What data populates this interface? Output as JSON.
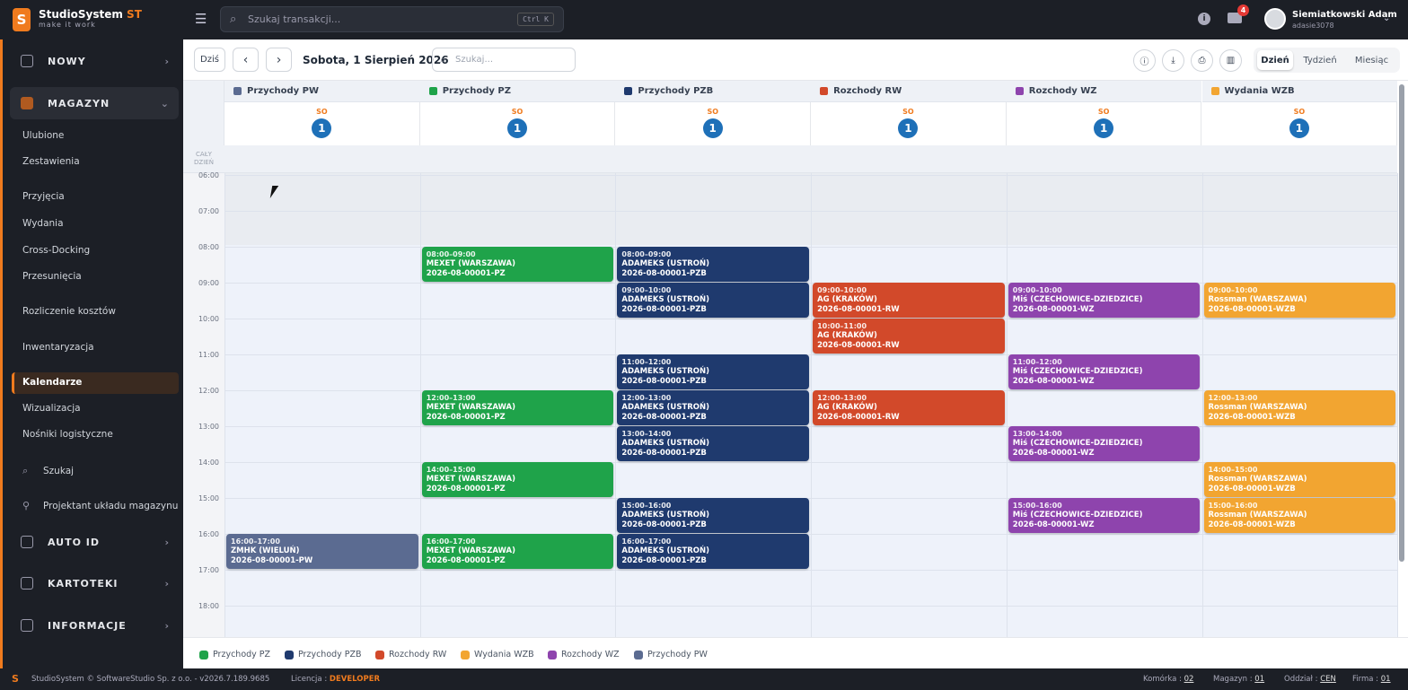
{
  "app": {
    "brand_main": "StudioSystem",
    "brand_accent": "ST",
    "tagline": "make it work",
    "logo_letter": "S"
  },
  "topbar": {
    "search_placeholder": "Szukaj transakcji...",
    "search_shortcut": "Ctrl K",
    "notifications_count": "4",
    "user_name": "Siemiatkowski Adam",
    "user_login": "adasie3078"
  },
  "sidebar": {
    "sections": {
      "nowy": "NOWY",
      "magazyn": "MAGAZYN",
      "auto_id": "AUTO ID",
      "kartoteki": "KARTOTEKI",
      "informacje": "INFORMACJE"
    },
    "items": [
      "Ulubione",
      "Zestawienia",
      "Przyjęcia",
      "Wydania",
      "Cross-Docking",
      "Przesunięcia",
      "Rozliczenie kosztów",
      "Inwentaryzacja",
      "Kalendarze",
      "Wizualizacja",
      "Nośniki logistyczne"
    ],
    "active_item": "Kalendarze",
    "search_label": "Szukaj",
    "designer_label": "Projektant układu magazynu"
  },
  "toolbar": {
    "today": "Dziś",
    "prev": "‹",
    "next": "›",
    "date": "Sobota, 1 Sierpień 2026",
    "search_placeholder": "Szukaj...",
    "views": [
      "Dzień",
      "Tydzień",
      "Miesiąc"
    ],
    "active_view": "Dzień"
  },
  "calendar": {
    "allday_label_1": "CAŁY",
    "allday_label_2": "DZIEŃ",
    "day_name": "SO",
    "day_number": "1",
    "hours": [
      "06:00",
      "07:00",
      "08:00",
      "09:00",
      "10:00",
      "11:00",
      "12:00",
      "13:00",
      "14:00",
      "15:00",
      "16:00",
      "17:00",
      "18:00"
    ],
    "columns": [
      {
        "name": "Przychody PW",
        "color": "#5b6b91"
      },
      {
        "name": "Przychody PZ",
        "color": "#1fa34a"
      },
      {
        "name": "Przychody PZB",
        "color": "#1f3a6e"
      },
      {
        "name": "Rozchody RW",
        "color": "#d2492a"
      },
      {
        "name": "Rozchody WZ",
        "color": "#8e44ad"
      },
      {
        "name": "Wydania WZB",
        "color": "#f2a531"
      }
    ],
    "events": [
      {
        "col": 0,
        "start": 16,
        "end": 17,
        "time": "16:00–17:00",
        "who": "ZMHK (WIELUŃ)",
        "doc": "2026-08-00001-PW"
      },
      {
        "col": 1,
        "start": 8,
        "end": 9,
        "time": "08:00–09:00",
        "who": "MEXET (WARSZAWA)",
        "doc": "2026-08-00001-PZ"
      },
      {
        "col": 1,
        "start": 12,
        "end": 13,
        "time": "12:00–13:00",
        "who": "MEXET (WARSZAWA)",
        "doc": "2026-08-00001-PZ"
      },
      {
        "col": 1,
        "start": 14,
        "end": 15,
        "time": "14:00–15:00",
        "who": "MEXET (WARSZAWA)",
        "doc": "2026-08-00001-PZ"
      },
      {
        "col": 1,
        "start": 16,
        "end": 17,
        "time": "16:00–17:00",
        "who": "MEXET (WARSZAWA)",
        "doc": "2026-08-00001-PZ"
      },
      {
        "col": 2,
        "start": 8,
        "end": 9,
        "time": "08:00–09:00",
        "who": "ADAMEKS (USTROŃ)",
        "doc": "2026-08-00001-PZB"
      },
      {
        "col": 2,
        "start": 9,
        "end": 10,
        "time": "09:00–10:00",
        "who": "ADAMEKS (USTROŃ)",
        "doc": "2026-08-00001-PZB"
      },
      {
        "col": 2,
        "start": 11,
        "end": 12,
        "time": "11:00–12:00",
        "who": "ADAMEKS (USTROŃ)",
        "doc": "2026-08-00001-PZB"
      },
      {
        "col": 2,
        "start": 12,
        "end": 13,
        "time": "12:00–13:00",
        "who": "ADAMEKS (USTROŃ)",
        "doc": "2026-08-00001-PZB"
      },
      {
        "col": 2,
        "start": 13,
        "end": 14,
        "time": "13:00–14:00",
        "who": "ADAMEKS (USTROŃ)",
        "doc": "2026-08-00001-PZB"
      },
      {
        "col": 2,
        "start": 15,
        "end": 16,
        "time": "15:00–16:00",
        "who": "ADAMEKS (USTROŃ)",
        "doc": "2026-08-00001-PZB"
      },
      {
        "col": 2,
        "start": 16,
        "end": 17,
        "time": "16:00–17:00",
        "who": "ADAMEKS (USTROŃ)",
        "doc": "2026-08-00001-PZB"
      },
      {
        "col": 3,
        "start": 9,
        "end": 10,
        "time": "09:00–10:00",
        "who": "AG (KRAKÓW)",
        "doc": "2026-08-00001-RW"
      },
      {
        "col": 3,
        "start": 10,
        "end": 11,
        "time": "10:00–11:00",
        "who": "AG (KRAKÓW)",
        "doc": "2026-08-00001-RW"
      },
      {
        "col": 3,
        "start": 12,
        "end": 13,
        "time": "12:00–13:00",
        "who": "AG (KRAKÓW)",
        "doc": "2026-08-00001-RW"
      },
      {
        "col": 4,
        "start": 9,
        "end": 10,
        "time": "09:00–10:00",
        "who": "Miś (CZECHOWICE-DZIEDZICE)",
        "doc": "2026-08-00001-WZ"
      },
      {
        "col": 4,
        "start": 11,
        "end": 12,
        "time": "11:00–12:00",
        "who": "Miś (CZECHOWICE-DZIEDZICE)",
        "doc": "2026-08-00001-WZ"
      },
      {
        "col": 4,
        "start": 13,
        "end": 14,
        "time": "13:00–14:00",
        "who": "Miś (CZECHOWICE-DZIEDZICE)",
        "doc": "2026-08-00001-WZ"
      },
      {
        "col": 4,
        "start": 15,
        "end": 16,
        "time": "15:00–16:00",
        "who": "Miś (CZECHOWICE-DZIEDZICE)",
        "doc": "2026-08-00001-WZ"
      },
      {
        "col": 5,
        "start": 9,
        "end": 10,
        "time": "09:00–10:00",
        "who": "Rossman (WARSZAWA)",
        "doc": "2026-08-00001-WZB"
      },
      {
        "col": 5,
        "start": 12,
        "end": 13,
        "time": "12:00–13:00",
        "who": "Rossman (WARSZAWA)",
        "doc": "2026-08-00001-WZB"
      },
      {
        "col": 5,
        "start": 14,
        "end": 15,
        "time": "14:00–15:00",
        "who": "Rossman (WARSZAWA)",
        "doc": "2026-08-00001-WZB"
      },
      {
        "col": 5,
        "start": 15,
        "end": 16,
        "time": "15:00–16:00",
        "who": "Rossman (WARSZAWA)",
        "doc": "2026-08-00001-WZB"
      }
    ]
  },
  "legend": [
    {
      "name": "Przychody PZ",
      "color": "#1fa34a"
    },
    {
      "name": "Przychody PZB",
      "color": "#1f3a6e"
    },
    {
      "name": "Rozchody RW",
      "color": "#d2492a"
    },
    {
      "name": "Wydania WZB",
      "color": "#f2a531"
    },
    {
      "name": "Rozchody WZ",
      "color": "#8e44ad"
    },
    {
      "name": "Przychody PW",
      "color": "#5b6b91"
    }
  ],
  "footer": {
    "copyright": "StudioSystem © SoftwareStudio Sp. z o.o. - v2026.7.189.9685",
    "license_label": "Licencja :",
    "license_value": "DEVELOPER",
    "cell_label": "Komórka :",
    "cell_value": "02",
    "warehouse_label": "Magazyn :",
    "warehouse_value": "01",
    "branch_label": "Oddział :",
    "branch_value": "CEN",
    "company_label": "Firma :",
    "company_value": "01"
  }
}
